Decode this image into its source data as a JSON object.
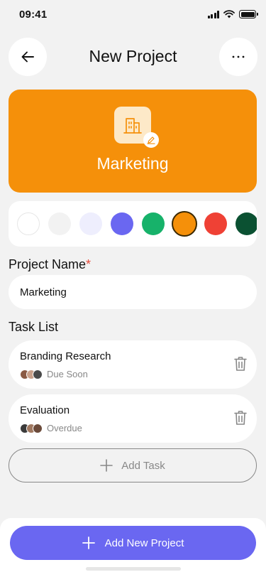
{
  "status_bar": {
    "time": "09:41"
  },
  "header": {
    "title": "New Project",
    "back_icon": "arrow-left-icon",
    "more_icon": "more-horizontal-icon"
  },
  "hero": {
    "name": "Marketing",
    "icon": "building-icon",
    "edit_icon": "pencil-icon",
    "color": "#f5900a"
  },
  "colors": {
    "swatches": [
      "#ffffff",
      "#f2f2f2",
      "#eeeefd",
      "#6a67f1",
      "#17b26a",
      "#f5900a",
      "#ef4135",
      "#0b5132"
    ],
    "selected": "#f5900a"
  },
  "project_name": {
    "label": "Project Name",
    "required_mark": "*",
    "value": "Marketing"
  },
  "task_list": {
    "label": "Task List",
    "tasks": [
      {
        "title": "Branding Research",
        "status": "Due Soon"
      },
      {
        "title": "Evaluation",
        "status": "Overdue"
      }
    ],
    "add_label": "Add Task"
  },
  "primary_action": {
    "label": "Add New Project",
    "icon": "plus-icon"
  }
}
